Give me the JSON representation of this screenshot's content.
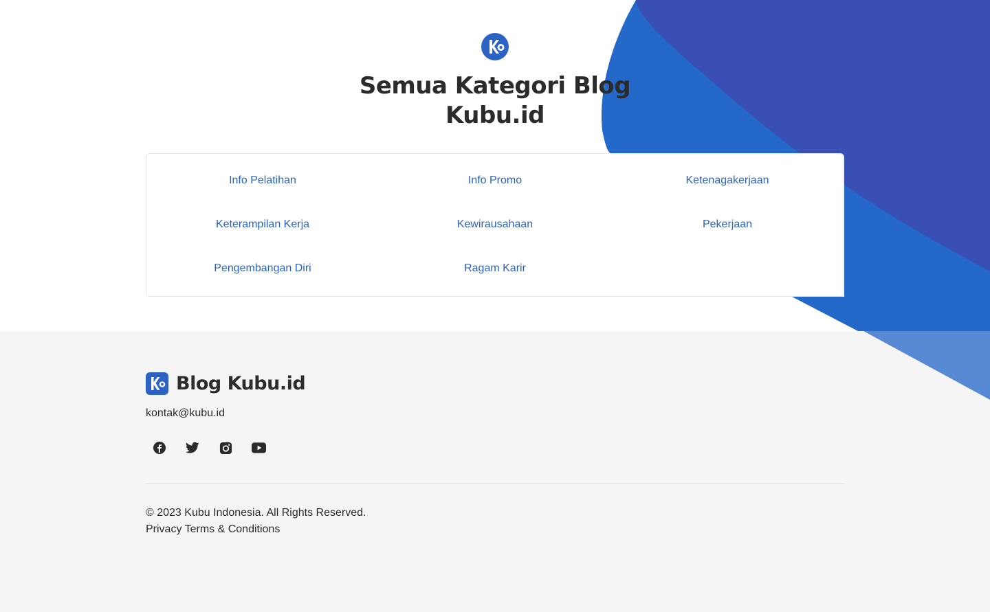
{
  "hero": {
    "title_line1": "Semua Kategori Blog",
    "title_line2": "Kubu.id",
    "logo_icon": "kubu-logo-icon"
  },
  "categories": [
    "Info Pelatihan",
    "Info Promo",
    "Ketenagakerjaan",
    "Keterampilan Kerja",
    "Kewirausahaan",
    "Pekerjaan",
    "Pengembangan Diri",
    "Ragam Karir"
  ],
  "footer": {
    "brand": "Blog Kubu.id",
    "email": "kontak@kubu.id",
    "socials": [
      "facebook-icon",
      "twitter-icon",
      "instagram-icon",
      "youtube-icon"
    ],
    "copyright": "© 2023 Kubu Indonesia. All Rights Reserved.",
    "privacy": "Privacy",
    "terms": "Terms & Conditions"
  },
  "colors": {
    "brand_blue": "#2b62c4",
    "shape_dark": "#3a4fb3",
    "shape_light": "#2468c9",
    "footer_bg": "#f5f5f5"
  }
}
